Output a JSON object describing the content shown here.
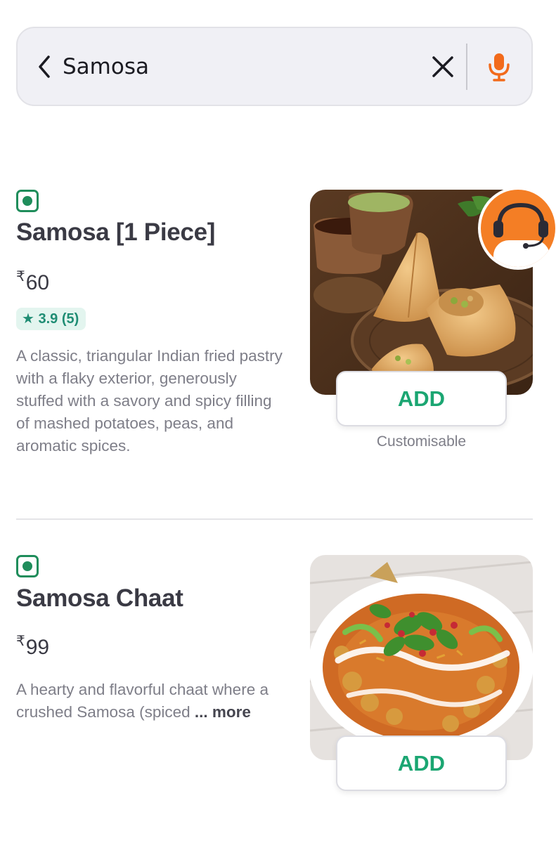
{
  "search": {
    "query": "Samosa"
  },
  "items": [
    {
      "name": "Samosa [1 Piece]",
      "currency": "₹",
      "price": "60",
      "rating": "3.9 (5)",
      "description": "A classic, triangular Indian fried pastry with a flaky exterior, generously stuffed with a savory and spicy filling of mashed potatoes, peas, and aromatic spices.",
      "add_label": "ADD",
      "customisable_label": "Customisable"
    },
    {
      "name": "Samosa Chaat",
      "currency": "₹",
      "price": "99",
      "description": "A hearty and flavorful chaat where a crushed Samosa (spiced",
      "ellipsis": " ...",
      "more_label": " more",
      "add_label": "ADD"
    }
  ],
  "colors": {
    "accent_green": "#1ba672",
    "veg_green": "#1f8d5b",
    "mic_orange": "#f26a1b",
    "support_orange": "#f47e25"
  },
  "icons": {
    "back": "chevron-left",
    "clear": "close-x",
    "mic": "microphone",
    "veg": "veg-indicator",
    "rating": "star",
    "support": "headset-agent"
  }
}
